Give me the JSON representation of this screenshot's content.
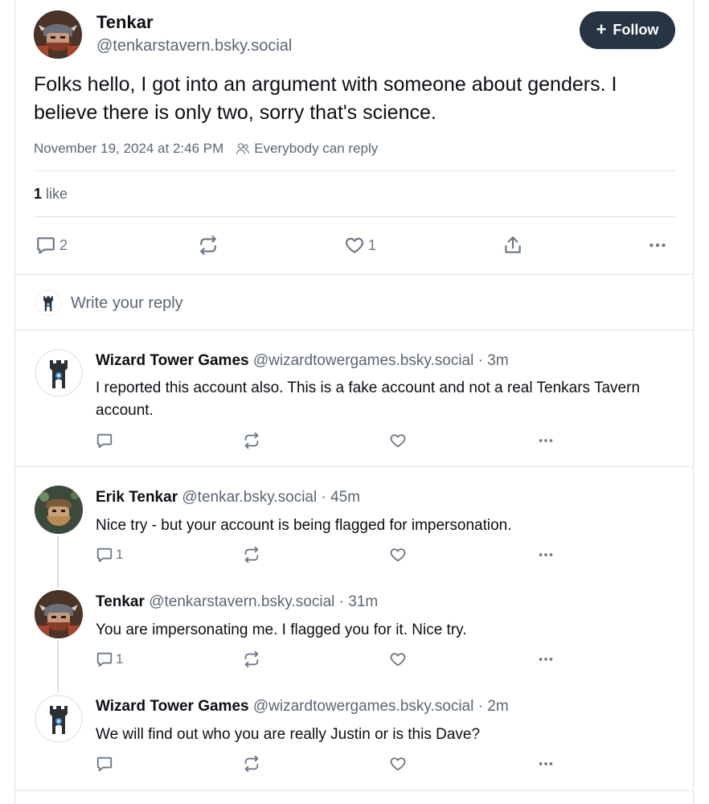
{
  "post": {
    "author_name": "Tenkar",
    "author_handle": "@tenkarstavern.bsky.social",
    "follow_label": "Follow",
    "text": "Folks hello, I got into an argument with someone about genders. I believe there is only two, sorry that's science.",
    "date": "November 19, 2024 at 2:46 PM",
    "reply_setting": "Everybody can reply",
    "likes_count": "1",
    "likes_label": "like",
    "actions": {
      "reply_count": "2",
      "like_count": "1"
    }
  },
  "composer": {
    "placeholder": "Write your reply"
  },
  "replies": [
    {
      "name": "Wizard Tower Games",
      "handle": "@wizardtowergames.bsky.social",
      "time": "· 3m",
      "text": "I reported this account also. This is a fake account and not a real Tenkars Tavern account.",
      "reply_count": ""
    },
    {
      "name": "Erik Tenkar",
      "handle": "@tenkar.bsky.social",
      "time": "· 45m",
      "text": "Nice try - but your account is being flagged for impersonation.",
      "reply_count": "1"
    },
    {
      "name": "Tenkar",
      "handle": "@tenkarstavern.bsky.social",
      "time": "· 31m",
      "text": "You are impersonating me. I flagged you for it. Nice try.",
      "reply_count": "1"
    },
    {
      "name": "Wizard Tower Games",
      "handle": "@wizardtowergames.bsky.social",
      "time": "· 2m",
      "text": "We will find out who you are really Justin or is this Dave?",
      "reply_count": ""
    }
  ],
  "colors": {
    "follow_bg": "#263444",
    "muted_text": "#5b6673",
    "divider": "#dfe3e8"
  },
  "icons": [
    "comment-icon",
    "repost-icon",
    "heart-icon",
    "share-icon",
    "more-icon",
    "people-icon",
    "plus-icon"
  ]
}
